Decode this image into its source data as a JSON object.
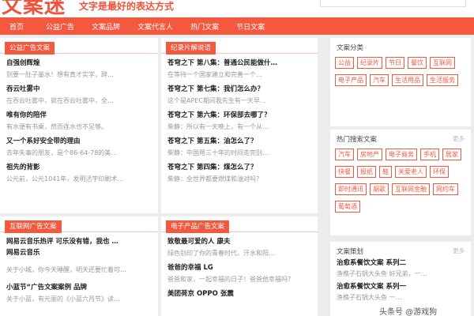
{
  "header": {
    "logo": "文案迷",
    "slogan": "文字是最好的表达方式"
  },
  "nav": [
    "首页",
    "公益广告",
    "文案品牌",
    "文案代言人",
    "热门文案",
    "节日文案"
  ],
  "sections": {
    "public": {
      "title": "公益广告文案",
      "articles": [
        {
          "title": "自强创辉煌",
          "snippet": "别要一肚子墨水！想有真才实学，辞…"
        },
        {
          "title": "吞云吐雾中",
          "snippet": "在吞云吐雾中，就在吞云吐雾中，全…"
        },
        {
          "title": "唯有你的陪伴",
          "snippet": "有水便有书桌，然而连水也不足够。"
        },
        {
          "title": "又一个系好安全带的理由",
          "snippet": "去年失事的朋友，是个86-64-78的美…"
        },
        {
          "title": "祖先的背影",
          "snippet": "公元前，公元1041年，发明活字印刷术…"
        }
      ]
    },
    "documentary": {
      "title": "纪录片解说语",
      "articles": [
        {
          "title": "苍穹之下 第八集：普通公民能做什…",
          "snippet": "在等待一个国家建立和完善一个…"
        },
        {
          "title": "苍穹之下 第七集：我们怎么办？",
          "snippet": "这个是APEC期间我先生有一天早…"
        },
        {
          "title": "苍穹之下 第六集：环保部去哪了？",
          "snippet": "柴静：所以有一天晚上，有一个从…"
        },
        {
          "title": "苍穹之下 第五集：油怎么了？",
          "snippet": "柴静：中国用三十年的时间走完别…"
        },
        {
          "title": "苍穹之下 第四集：煤怎么了？",
          "snippet": "柴静：全世界都要燃煤和油对吗？"
        }
      ]
    },
    "internet": {
      "title": "互联网广告文案",
      "articles": [
        {
          "title": "网易云音乐热评 可乐没有错，我也 … 网易云音乐",
          "snippet": ""
        },
        {
          "title": "",
          "snippet": "关于小城，你今天睡醒，明天还要忙着可…"
        },
        {
          "title": "小蓝节“广告文案案例 品牌",
          "snippet": "关于小蓝，有元丽的《小蓝六月节》读…"
        }
      ]
    },
    "electronics": {
      "title": "电子产品广告文案",
      "articles": [
        {
          "title": "致敬最可爱的人 康夫",
          "snippet": "绿色别印了你的青春时代，汗水和阳…"
        },
        {
          "title": "爸爸的幸福 LG",
          "snippet": "爸爸和家，一起幸福的日子！爸爸他幸福吗？"
        },
        {
          "title": "美团荷京 OPPO 张震",
          "snippet": ""
        }
      ]
    }
  },
  "sidebar": {
    "categories": {
      "title": "文案分类",
      "tags": [
        "公益",
        "纪录片",
        "节日",
        "餐饮",
        "互联网",
        "电子产品",
        "汽车",
        "生活用品",
        "生活服务"
      ]
    },
    "hot": {
      "title": "热门搜索文案",
      "more": "更多",
      "tags": [
        "汽车",
        "房地产",
        "电子商务",
        "手机",
        "居家",
        "快餐",
        "报纸",
        "鞋",
        "关爱老人",
        "环保",
        "即时通讯",
        "胡歌",
        "互联网金融",
        "网约车",
        "葡萄酒"
      ]
    },
    "plan": {
      "title": "文案策划",
      "more": "更多",
      "items": [
        {
          "title": "治愈系餐饮文案 系列二",
          "snippet": "渔樵子石锅大头鱼 好兄弟，一…"
        },
        {
          "title": "治愈系餐饮文案 系列一",
          "snippet": "渔樵子石锅大头鱼 一…"
        }
      ]
    }
  },
  "watermark": "头条号 @游戏狗"
}
